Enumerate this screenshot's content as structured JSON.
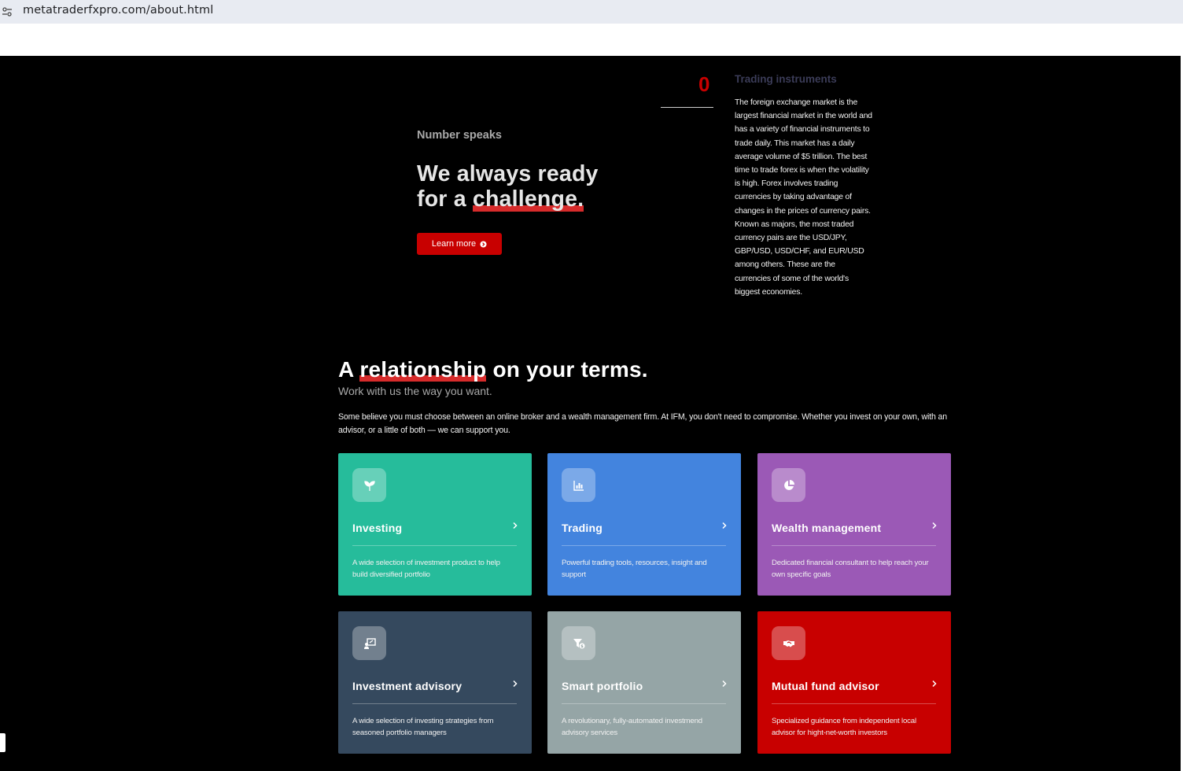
{
  "browser": {
    "url": "metatraderfxpro.com/about.html",
    "site_info_icon": "tune-icon"
  },
  "hero": {
    "kicker": "Number speaks",
    "headline_line1": "We always ready",
    "headline_line2_pre": "for a ",
    "headline_line2_mark": "challenge.",
    "cta_label": "Learn more",
    "cta_icon": "arrow-circle-icon"
  },
  "stat": {
    "counter_value": "0",
    "title": "Trading instruments",
    "description": "The foreign exchange market is the largest financial market in the world and has a variety of financial instruments to trade daily. This market has a daily average volume of $5 trillion. The best time to trade forex is when the volatility is high. Forex involves trading currencies by taking advantage of changes in the prices of currency pairs. Known as majors, the most traded currency pairs are the USD/JPY, GBP/USD, USD/CHF, and EUR/USD among others. These are the currencies of some of the world's biggest economies."
  },
  "section": {
    "title_pre": "A ",
    "title_mark": "relationship",
    "title_post": " on your terms.",
    "subtitle": "Work with us the way you want.",
    "paragraph": "Some believe you must choose between an online broker and a wealth management firm. At IFM, you don't need to compromise. Whether you invest on your own, with an advisor, or a little of both — we can support you."
  },
  "cards": [
    {
      "title": "Investing",
      "description": "A wide selection of investment product to help build diversified portfolio",
      "icon": "seedling-icon",
      "color": "#26bc9b"
    },
    {
      "title": "Trading",
      "description": "Powerful trading tools, resources, insight and support",
      "icon": "chart-bar-icon",
      "color": "#4384de"
    },
    {
      "title": "Wealth management",
      "description": "Dedicated financial consultant to help reach your own specific goals",
      "icon": "pie-chart-icon",
      "color": "#9b59b6"
    },
    {
      "title": "Investment advisory",
      "description": "A wide selection of investing strategies from seasoned portfolio managers",
      "icon": "advisor-board-icon",
      "color": "#35495e"
    },
    {
      "title": "Smart portfolio",
      "description": "A revolutionary, fully-automated investmend advisory services",
      "icon": "filter-dollar-icon",
      "color": "#95a5a6"
    },
    {
      "title": "Mutual fund advisor",
      "description": "Specialized guidance from independent local advisor for hight-net-worth investors",
      "icon": "handshake-icon",
      "color": "#c80000"
    }
  ]
}
